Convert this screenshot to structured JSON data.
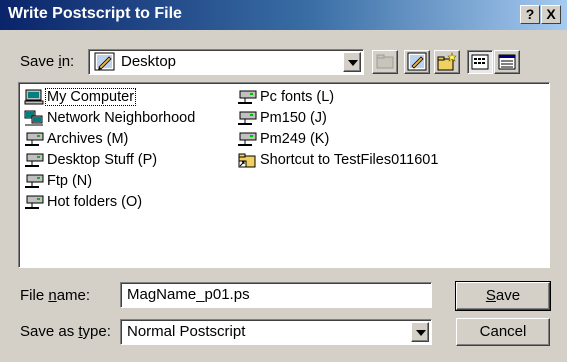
{
  "window": {
    "title": "Write Postscript to File",
    "help_label": "?",
    "close_label": "X"
  },
  "savein": {
    "label_pre": "Save ",
    "label_key": "i",
    "label_post": "n:",
    "value": "Desktop"
  },
  "files": [
    {
      "name": "My Computer",
      "icon": "my-computer-icon"
    },
    {
      "name": "Network Neighborhood",
      "icon": "network-icon"
    },
    {
      "name": "Archives (M)",
      "icon": "network-drive-icon"
    },
    {
      "name": "Desktop Stuff (P)",
      "icon": "network-drive-icon"
    },
    {
      "name": "Ftp (N)",
      "icon": "network-drive-icon"
    },
    {
      "name": "Hot folders (O)",
      "icon": "network-drive-icon"
    },
    {
      "name": "Pc fonts (L)",
      "icon": "network-drive-icon"
    },
    {
      "name": "Pm150 (J)",
      "icon": "network-drive-icon"
    },
    {
      "name": "Pm249 (K)",
      "icon": "network-drive-icon"
    },
    {
      "name": "Shortcut to TestFiles011601",
      "icon": "folder-shortcut-icon"
    }
  ],
  "filename": {
    "label_pre": "File ",
    "label_key": "n",
    "label_post": "ame:",
    "value": "MagName_p01.ps"
  },
  "savetype": {
    "label_pre": "Save as ",
    "label_key": "t",
    "label_post": "ype:",
    "value": "Normal Postscript"
  },
  "buttons": {
    "save_key": "S",
    "save_rest": "ave",
    "cancel": "Cancel"
  },
  "colors": {
    "title_start": "#0a246a",
    "title_end": "#a6caf0",
    "face": "#d4d0c8"
  }
}
